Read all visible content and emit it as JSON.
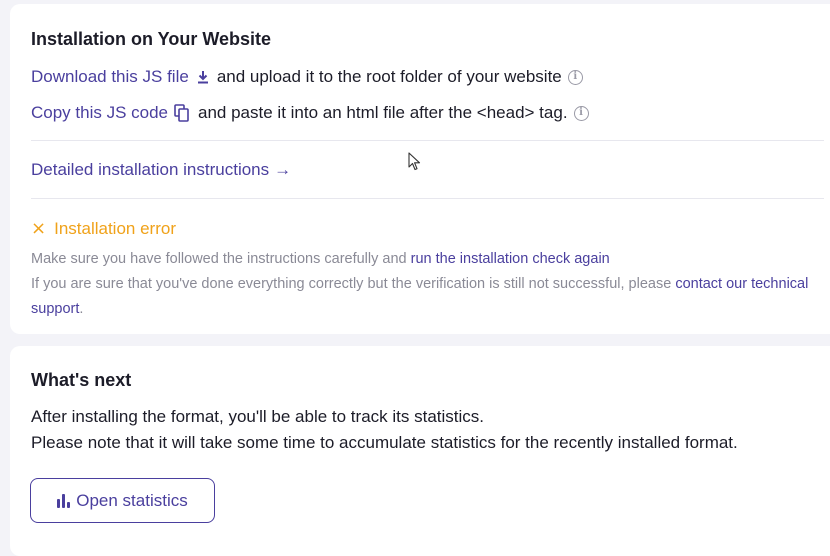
{
  "installation": {
    "title": "Installation on Your Website",
    "download_link": "Download this JS file",
    "download_rest": "and upload it to the root folder of your website",
    "copy_link": "Copy this JS code",
    "copy_rest": "and paste it into an html file after the <head> tag.",
    "instructions_link": "Detailed installation instructions",
    "arrow": "→",
    "error_icon": "×",
    "error_label": "Installation error",
    "help1_text": "Make sure you have followed the instructions carefully and",
    "help1_link": "run the installation check again",
    "help2_text": "If you are sure that you've done everything correctly but the verification is still not successful, please",
    "help2_link": "contact our technical support",
    "help2_end": "."
  },
  "next": {
    "title": "What's next",
    "line1": "After installing the format, you'll be able to track its statistics.",
    "line2": "Please note that it will take some time to accumulate statistics for the recently installed format.",
    "button_label": "Open statistics"
  },
  "icons": {
    "download": "download-icon",
    "copy": "copy-icon",
    "info": "info-icon",
    "error": "close-icon",
    "stats": "bar-chart-icon"
  },
  "colors": {
    "link": "#4a3f9e",
    "error": "#f0a21a",
    "muted": "#8a8a96",
    "text": "#1c1c28"
  },
  "info_glyph": "i"
}
